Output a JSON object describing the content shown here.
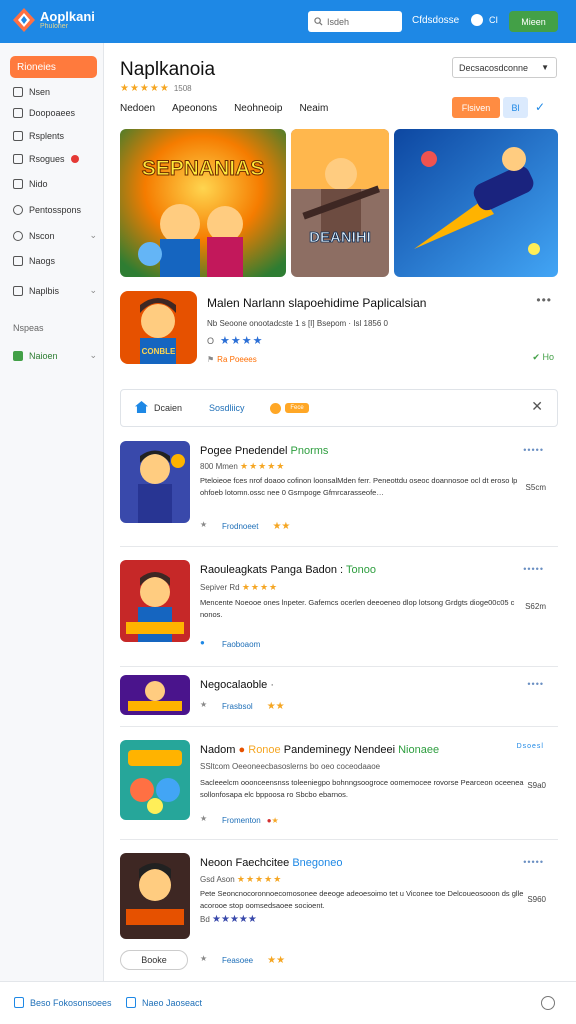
{
  "app": {
    "title": "Aoplkani",
    "subtitle": "Phuloner",
    "search_placeholder": "Isdeh",
    "top_link": "Cfdsdosse",
    "top_icon_label": "CI",
    "top_button": "Mieen"
  },
  "sidebar": {
    "active": "Rioneies",
    "items": [
      {
        "label": "Nsen"
      },
      {
        "label": "Doopoaees"
      },
      {
        "label": "Rsplents"
      },
      {
        "label": "Rsogues"
      },
      {
        "label": "Nido"
      },
      {
        "label": "Pentosspons"
      },
      {
        "label": "Nscon",
        "chevron": "⌄"
      },
      {
        "label": "Naogs"
      },
      {
        "label": "Naplbis",
        "chevron": "⌄"
      }
    ],
    "section_label": "Nspeas",
    "section_item": "Naioen",
    "section_item_chevron": "⌄"
  },
  "header": {
    "title": "Naplkanoia",
    "rating_count": "1508",
    "sort_dropdown": "Decsacosdconne",
    "tabs": [
      "Nedoen",
      "Apeonons",
      "Neohneoip",
      "Neaim"
    ],
    "primary_button": "Flsiven",
    "icon_button_label": "Bl"
  },
  "banners": [
    {
      "title": "SEPNANIAS"
    },
    {
      "title": "DEANIHI"
    },
    {
      "title": ""
    }
  ],
  "featured": {
    "title": "Malen Narlann slapoehidime Paplicalsian",
    "meta": "Nb Seoone onootadcste 1 s [I] Bsepom · Isl 1856 0",
    "stars_prefix": "O",
    "link": "Ra Poeees",
    "badge": "Ho",
    "icon_caption": "CONBLE"
  },
  "filter": {
    "label1": "Dcaien",
    "label2": "Sosdliicy",
    "pill": "Fece"
  },
  "list": [
    {
      "title": "Pogee Pnedendel",
      "title_accent": "Pnorms",
      "sub": "800 Mmen",
      "desc": "Pteloieoe fces nrof doaoo cofinon loonsalMden ferr. Peneottdu oseoc doannosoe ocl dt eroso lp ohfoeb lotomn.ossc nee 0 Gsrnpoge Gfmrcarasseofe…",
      "price": "S5cm",
      "foot_label": "Frodnoeet",
      "more": "•••••"
    },
    {
      "title": "Raouleagkats Panga Badon :",
      "title_accent": "Tonoo",
      "sub": "Sepiver Rd",
      "desc": "Mencente Noeooe ones lnpeter. Gafemcs ocerlen deeoeneo dlop lotsong Grdgts dioge00c05 c nonos.",
      "price": "S62m",
      "foot_label": "Faoboaom",
      "more": "•••••"
    },
    {
      "title": "Negocalaoble",
      "title_accent": "",
      "sub": "",
      "desc": "",
      "price": "",
      "foot_label": "Frasbsol",
      "more": "••••"
    },
    {
      "title": "Nadom",
      "title_accent": "Pandeminegy Nendeei",
      "title_accent2": "Ronoe",
      "title_tail": "Nionaee",
      "sub": "SSltcom  Oeeoneecbasoslerns bo oeo coceodaaoe",
      "desc": "Sacleeelcm ooonceensnss toleeniegpo bohnngsoogroce oomemocee rovorse Pearceon oceenea sollonfosapa elc bppoosa ro Sbcbo ebarnos.",
      "price": "S9a0",
      "foot_label": "Fromenton",
      "more": "Dsoesl"
    },
    {
      "title": "Neoon Faechcitee",
      "title_accent": "Bnegoneo",
      "sub": "Gsd Ason",
      "desc": "Pete Seoncnocoronnoecomosonee deeoge adeoesoimo tet u Viconee toe Delcoueosooon ds glle acorooe stop oomsedsaoee socioent. ",
      "desc_extra": "Bd",
      "price": "S960",
      "foot_label": "Feasoee",
      "more": "•••••"
    }
  ],
  "footer": {
    "pill_button": "Booke",
    "link1": "Beso Fokosonsoees",
    "link2": "Naeo Jaoseact"
  },
  "colors": {
    "topbar": "#1e88e5",
    "accent_orange": "#ff7a3d",
    "accent_green": "#43a047",
    "star": "#f5a623"
  }
}
